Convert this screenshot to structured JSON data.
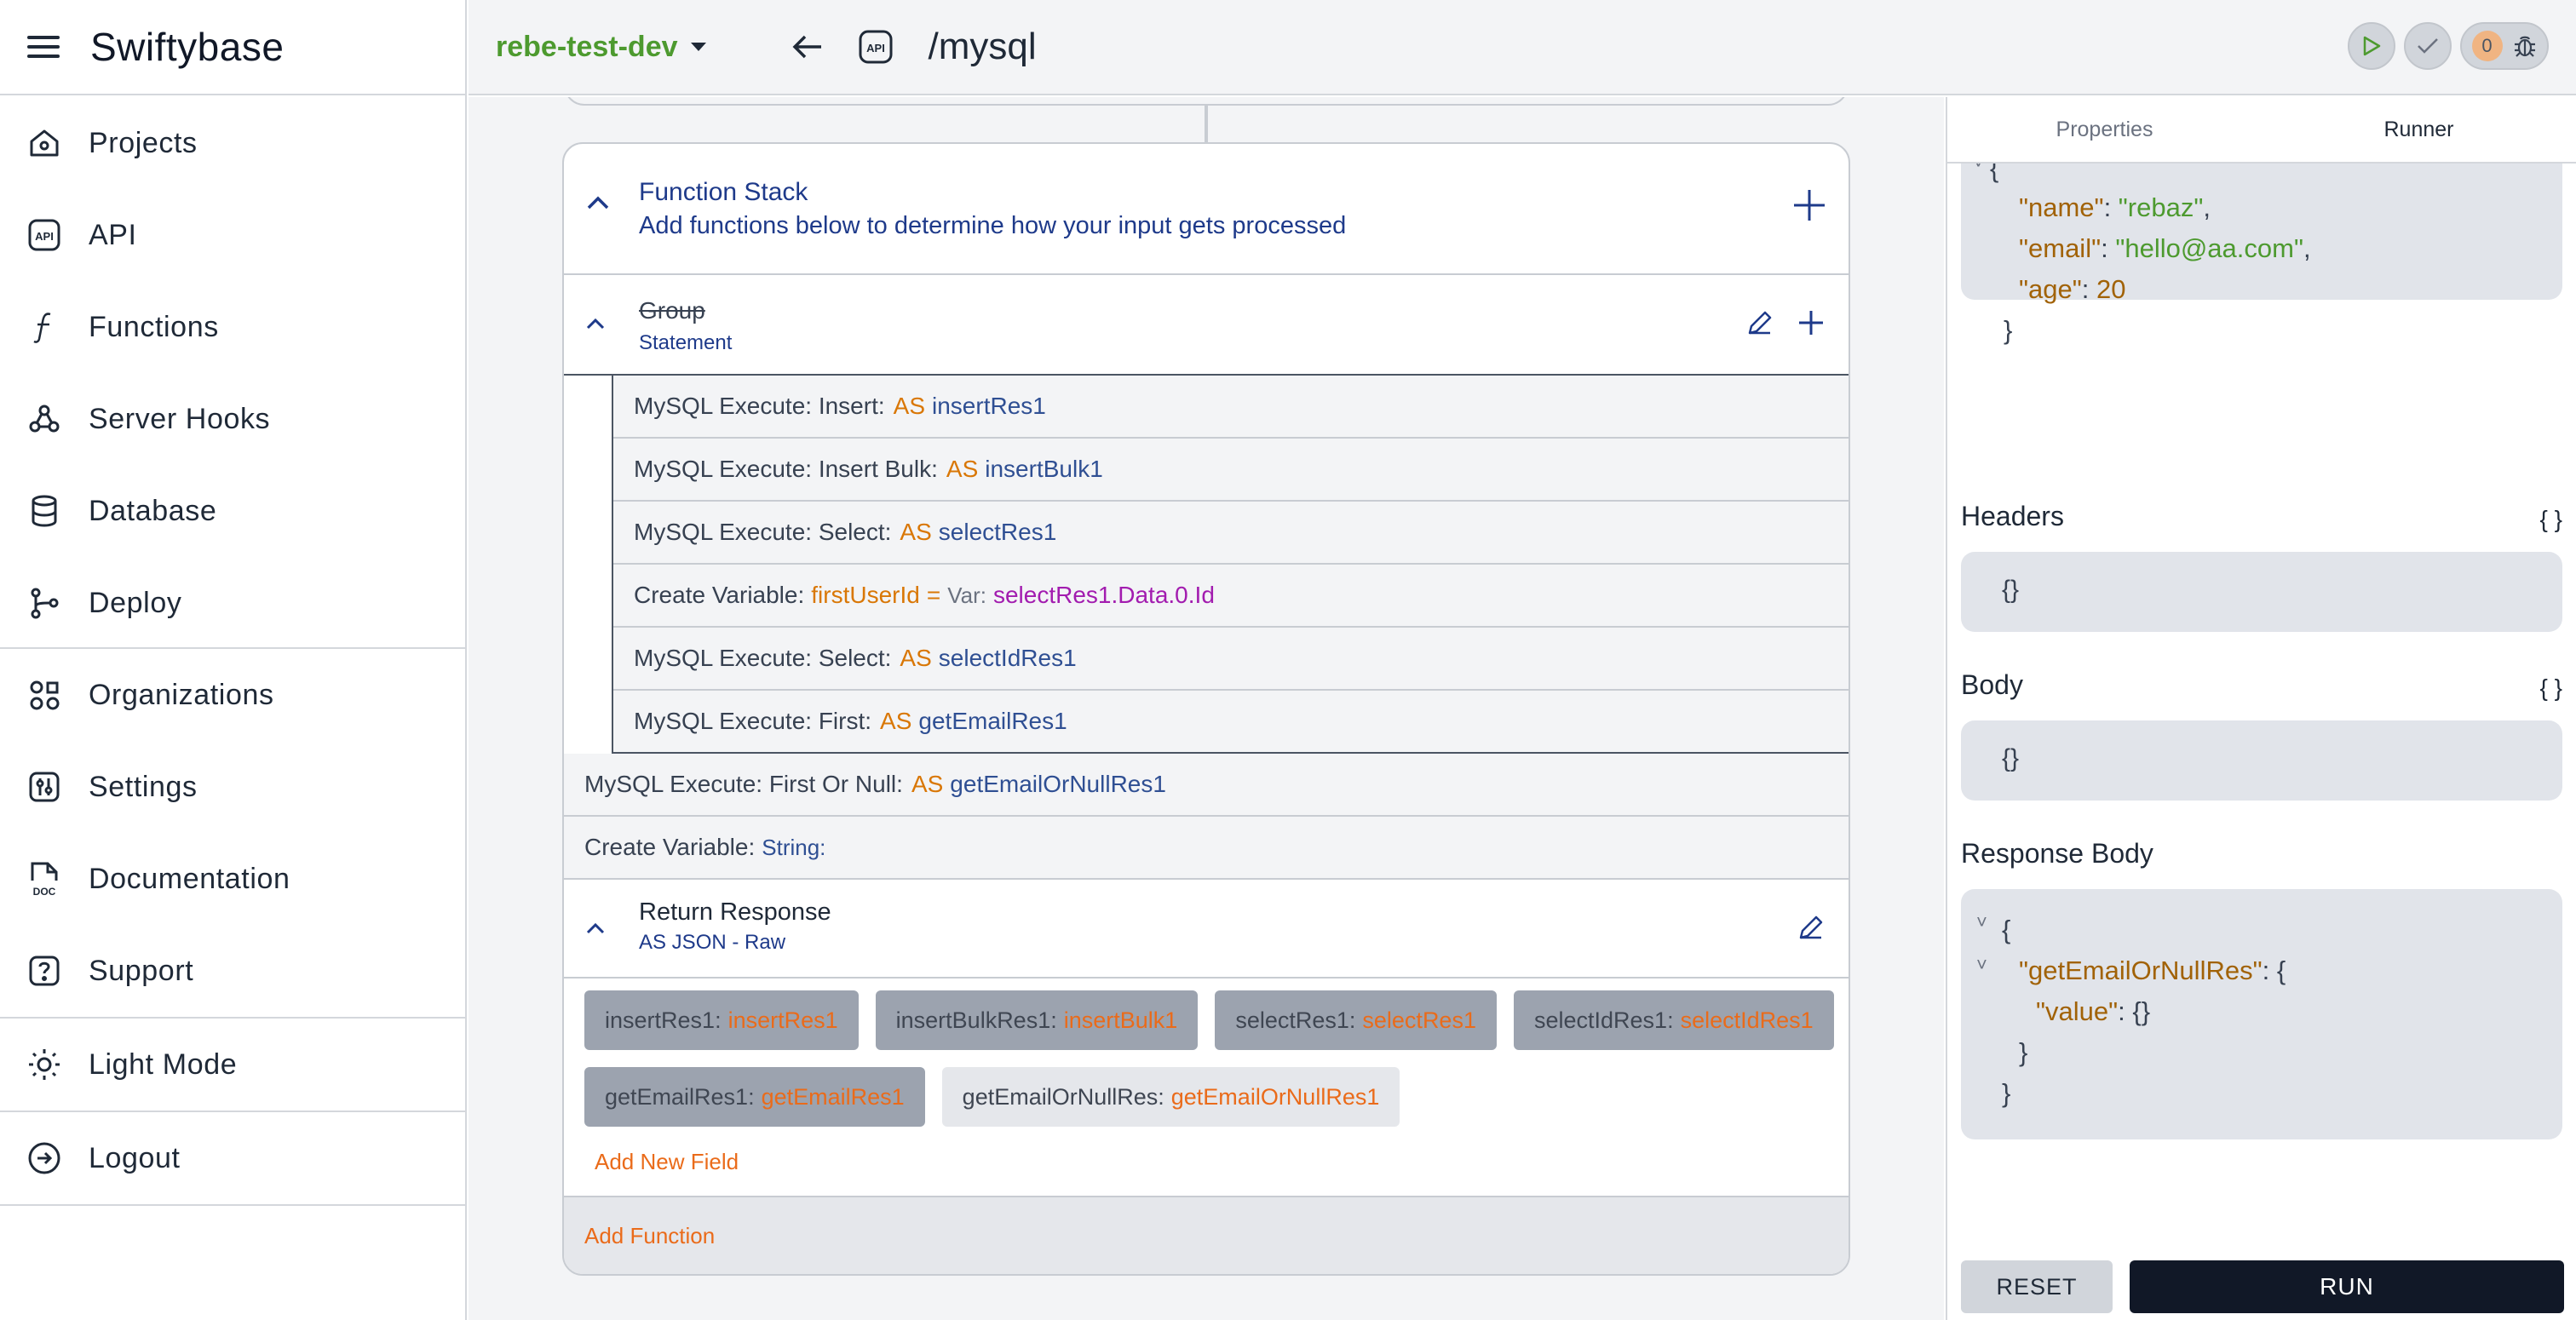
{
  "app": {
    "name": "Swiftybase"
  },
  "sidebar": {
    "items": [
      {
        "label": "Projects",
        "icon": "home-icon"
      },
      {
        "label": "API",
        "icon": "api-icon"
      },
      {
        "label": "Functions",
        "icon": "function-icon"
      },
      {
        "label": "Server Hooks",
        "icon": "webhook-icon"
      },
      {
        "label": "Database",
        "icon": "database-icon"
      },
      {
        "label": "Deploy",
        "icon": "git-branch-icon"
      },
      {
        "label": "Organizations",
        "icon": "organizations-icon"
      },
      {
        "label": "Settings",
        "icon": "settings-icon"
      },
      {
        "label": "Documentation",
        "icon": "doc-icon"
      },
      {
        "label": "Support",
        "icon": "help-icon"
      },
      {
        "label": "Light Mode",
        "icon": "sun-icon"
      },
      {
        "label": "Logout",
        "icon": "logout-icon"
      }
    ]
  },
  "topbar": {
    "project": "rebe-test-dev",
    "api_badge": "API",
    "route": "/mysql",
    "debug_count": "0"
  },
  "function_stack": {
    "title": "Function Stack",
    "subtitle": "Add functions below to determine how your input gets processed",
    "group": {
      "title": "Group",
      "subtitle": "Statement",
      "rows": [
        {
          "pre": "MySQL Execute: Insert:",
          "as": "AS",
          "var": "insertRes1"
        },
        {
          "pre": "MySQL Execute: Insert Bulk:",
          "as": "AS",
          "var": "insertBulk1"
        },
        {
          "pre": "MySQL Execute: Select:",
          "as": "AS",
          "var": "selectRes1"
        },
        {
          "pre": "Create Variable:",
          "vname": "firstUserId",
          "eq": "=",
          "vt": "Var:",
          "path": "selectRes1.Data.0.Id"
        },
        {
          "pre": "MySQL Execute: Select:",
          "as": "AS",
          "var": "selectIdRes1"
        },
        {
          "pre": "MySQL Execute: First:",
          "as": "AS",
          "var": "getEmailRes1"
        }
      ]
    },
    "outer_rows": [
      {
        "pre": "MySQL Execute: First Or Null:",
        "as": "AS",
        "var": "getEmailOrNullRes1"
      },
      {
        "pre": "Create Variable:",
        "type": "String:"
      }
    ],
    "return_response": {
      "title": "Return Response",
      "subtitle": "AS JSON - Raw",
      "fields": [
        {
          "key": "insertRes1",
          "value": "insertRes1"
        },
        {
          "key": "insertBulkRes1",
          "value": "insertBulk1"
        },
        {
          "key": "selectRes1",
          "value": "selectRes1"
        },
        {
          "key": "selectIdRes1",
          "value": "selectIdRes1"
        },
        {
          "key": "getEmailRes1",
          "value": "getEmailRes1"
        },
        {
          "key": "getEmailOrNullRes",
          "value": "getEmailOrNullRes1"
        }
      ],
      "add_field": "Add New Field"
    },
    "add_function": "Add Function"
  },
  "runner": {
    "tabs": [
      "Properties",
      "Runner"
    ],
    "request": {
      "name_key": "\"name\"",
      "name_val": "\"rebaz\"",
      "email_key": "\"email\"",
      "email_val": "\"hello@aa.com\"",
      "age_key": "\"age\"",
      "age_val": "20"
    },
    "headers_title": "Headers",
    "headers_value": "{}",
    "body_title": "Body",
    "body_value": "{}",
    "braces": "{ }",
    "response_title": "Response Body",
    "response": {
      "outer_key": "\"getEmailOrNullRes\"",
      "inner_key": "\"value\"",
      "inner_val": "{}"
    },
    "reset_label": "RESET",
    "run_label": "RUN"
  },
  "colors": {
    "accent_green": "#4d9a2f",
    "accent_orange": "#ea6b1a",
    "navy": "#1e3a8a"
  }
}
